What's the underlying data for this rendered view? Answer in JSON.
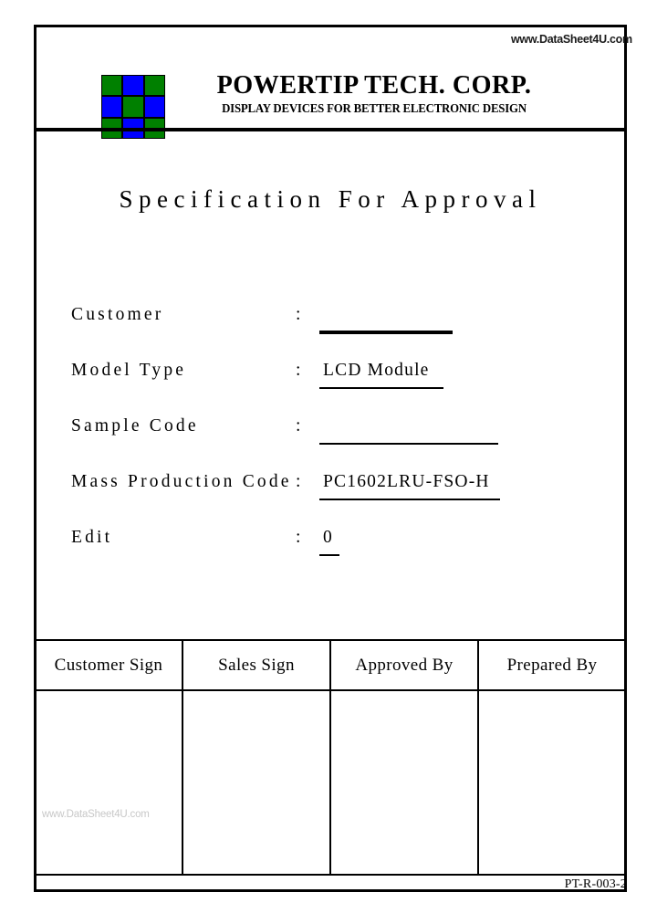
{
  "document": {
    "title": "Specification For Approval",
    "footer_code": "PT-R-003-2"
  },
  "header": {
    "company_name": "POWERTIP TECH. CORP.",
    "tagline": "DISPLAY DEVICES FOR BETTER ELECTRONIC DESIGN",
    "watermark": "www.DataSheet4U.com",
    "logo": {
      "name": "powertip-logo",
      "colors": {
        "green": "#008000",
        "blue": "#0000ff"
      },
      "cells": [
        "green",
        "blue",
        "green",
        "blue",
        "green",
        "blue",
        "green",
        "blue",
        "green"
      ]
    }
  },
  "fields": [
    {
      "label": "Customer",
      "separator": ":",
      "value": ""
    },
    {
      "label": "Model Type",
      "separator": ":",
      "value": "LCD Module"
    },
    {
      "label": "Sample Code",
      "separator": ":",
      "value": ""
    },
    {
      "label": "Mass Production Code",
      "separator": ":",
      "value": "PC1602LRU-FSO-H"
    },
    {
      "label": "Edit",
      "separator": ":",
      "value": "0"
    }
  ],
  "signature_table": {
    "headers": [
      "Customer Sign",
      "Sales Sign",
      "Approved By",
      "Prepared By"
    ],
    "cells": [
      "",
      "",
      "",
      ""
    ]
  },
  "watermarks": {
    "body": "www.DataSheet4U.com"
  }
}
